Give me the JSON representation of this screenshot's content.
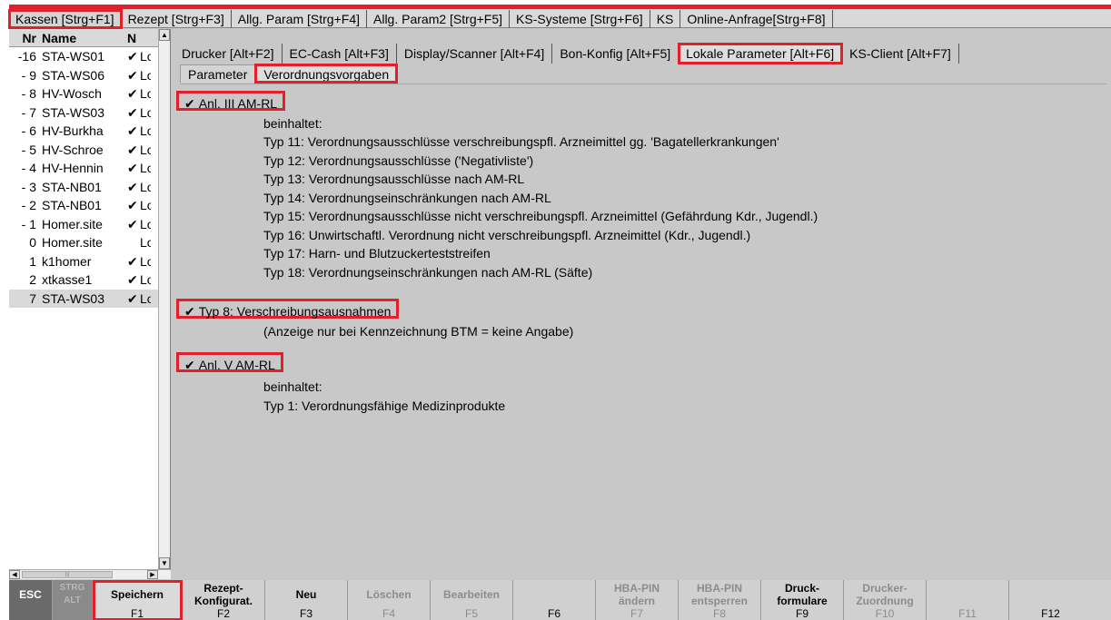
{
  "top_tabs": [
    {
      "label": "Kassen [Strg+F1]"
    },
    {
      "label": "Rezept [Strg+F3]"
    },
    {
      "label": "Allg. Param [Strg+F4]"
    },
    {
      "label": "Allg. Param2 [Strg+F5]"
    },
    {
      "label": "KS-Systeme [Strg+F6]"
    },
    {
      "label": "KS"
    },
    {
      "label": "Online-Anfrage[Strg+F8]"
    }
  ],
  "list": {
    "headers": {
      "nr": "Nr",
      "name": "Name",
      "n": "N"
    },
    "rows": [
      {
        "nr": "-16",
        "name": "STA-WS01",
        "chk": "✔",
        "n": "Lo"
      },
      {
        "nr": "- 9",
        "name": "STA-WS06",
        "chk": "✔",
        "n": "Lo"
      },
      {
        "nr": "- 8",
        "name": "HV-Wosch",
        "chk": "✔",
        "n": "Lo"
      },
      {
        "nr": "- 7",
        "name": "STA-WS03",
        "chk": "✔",
        "n": "Lo"
      },
      {
        "nr": "- 6",
        "name": "HV-Burkha",
        "chk": "✔",
        "n": "Lo"
      },
      {
        "nr": "- 5",
        "name": "HV-Schroe",
        "chk": "✔",
        "n": "Lo"
      },
      {
        "nr": "- 4",
        "name": "HV-Hennin",
        "chk": "✔",
        "n": "Lo"
      },
      {
        "nr": "- 3",
        "name": "STA-NB01",
        "chk": "✔",
        "n": "Lo"
      },
      {
        "nr": "- 2",
        "name": "STA-NB01",
        "chk": "✔",
        "n": "Lo"
      },
      {
        "nr": "- 1",
        "name": "Homer.site",
        "chk": "✔",
        "n": "Lo"
      },
      {
        "nr": "0",
        "name": "Homer.site",
        "chk": "",
        "n": "Lo"
      },
      {
        "nr": "1",
        "name": "k1homer",
        "chk": "✔",
        "n": "Lo"
      },
      {
        "nr": "2",
        "name": "xtkasse1",
        "chk": "✔",
        "n": "Lo"
      },
      {
        "nr": "7",
        "name": "STA-WS03",
        "chk": "✔",
        "n": "Lo"
      }
    ]
  },
  "sub_tabs": [
    {
      "label": "Drucker [Alt+F2]"
    },
    {
      "label": "EC-Cash [Alt+F3]"
    },
    {
      "label": "Display/Scanner [Alt+F4]"
    },
    {
      "label": "Bon-Konfig [Alt+F5]"
    },
    {
      "label": "Lokale Parameter [Alt+F6]"
    },
    {
      "label": "KS-Client [Alt+F7]"
    }
  ],
  "inner_tabs": [
    {
      "label": "Parameter"
    },
    {
      "label": "Verordnungsvorgaben"
    }
  ],
  "anl3": {
    "checkbox_label": "Anl. III AM-RL",
    "check": "✔",
    "intro": "beinhaltet:",
    "items": [
      "Typ 11: Verordnungsausschlüsse verschreibungspfl. Arzneimittel gg. 'Bagatellerkrankungen'",
      "Typ 12: Verordnungsausschlüsse ('Negativliste')",
      "Typ 13: Verordnungsausschlüsse nach AM-RL",
      "Typ 14: Verordnungseinschränkungen nach AM-RL",
      "Typ 15: Verordnungsausschlüsse nicht verschreibungspfl. Arzneimittel (Gefährdung Kdr., Jugendl.)",
      "Typ 16: Unwirtschaftl. Verordnung nicht verschreibungspfl. Arzneimittel (Kdr., Jugendl.)",
      "Typ 17: Harn- und Blutzuckerteststreifen",
      "Typ 18: Verordnungseinschränkungen nach AM-RL (Säfte)"
    ]
  },
  "typ8": {
    "checkbox_label": "Typ 8: Verschreibungsausnahmen",
    "check": "✔",
    "note": "(Anzeige nur bei Kennzeichnung BTM = keine Angabe)"
  },
  "anl5": {
    "checkbox_label": "Anl. V AM-RL",
    "check": "✔",
    "intro": "beinhaltet:",
    "items": [
      "Typ 1: Verordnungsfähige Medizinprodukte"
    ]
  },
  "fkeys": [
    {
      "label": "ESC",
      "key": ""
    },
    {
      "label": "STRG ALT",
      "key": ""
    },
    {
      "label": "Speichern",
      "key": "F1"
    },
    {
      "label": "Rezept-\nKonfigurat.",
      "key": "F2"
    },
    {
      "label": "Neu",
      "key": "F3"
    },
    {
      "label": "Löschen",
      "key": "F4"
    },
    {
      "label": "Bearbeiten",
      "key": "F5"
    },
    {
      "label": "",
      "key": "F6"
    },
    {
      "label": "HBA-PIN\nändern",
      "key": "F7"
    },
    {
      "label": "HBA-PIN\nentsperren",
      "key": "F8"
    },
    {
      "label": "Druck-\nformulare",
      "key": "F9"
    },
    {
      "label": "Drucker-\nZuordnung",
      "key": "F10"
    },
    {
      "label": "",
      "key": "F11"
    },
    {
      "label": "",
      "key": "F12"
    }
  ]
}
